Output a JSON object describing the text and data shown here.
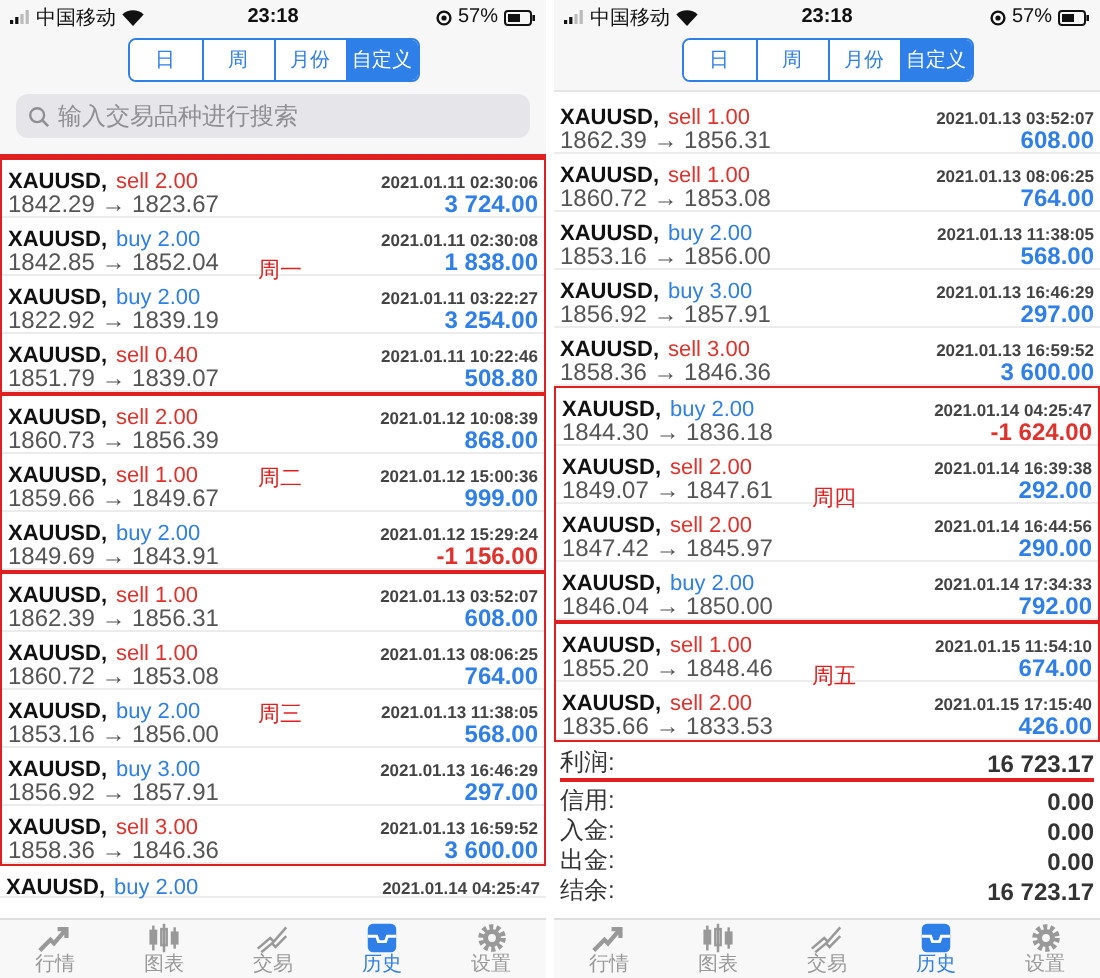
{
  "panels": [
    {
      "status_bar": {
        "carrier": "中国移动",
        "time": "23:18",
        "battery": "57%"
      },
      "segments": [
        {
          "label": "日",
          "selected": false
        },
        {
          "label": "周",
          "selected": false
        },
        {
          "label": "月份",
          "selected": false
        },
        {
          "label": "自定义",
          "selected": true
        }
      ],
      "search": {
        "placeholder": "输入交易品种进行搜索"
      },
      "groups": [
        {
          "annotation": "周一",
          "rows": [
            {
              "symbol": "XAUUSD,",
              "volume": "sell 2.00",
              "color": "#e0322c",
              "time": "2021.01.11 02:30:06",
              "prices": "1842.29 → 1823.67",
              "profit": "3 724.00",
              "loss": false
            },
            {
              "symbol": "XAUUSD,",
              "volume": "buy 2.00",
              "color": "#2f7fe8",
              "time": "2021.01.11 02:30:08",
              "prices": "1842.85 → 1852.04",
              "profit": "1 838.00",
              "loss": false
            },
            {
              "symbol": "XAUUSD,",
              "volume": "buy 2.00",
              "color": "#2f7fe8",
              "time": "2021.01.11 03:22:27",
              "prices": "1822.92 → 1839.19",
              "profit": "3 254.00",
              "loss": false
            },
            {
              "symbol": "XAUUSD,",
              "volume": "sell 0.40",
              "color": "#e0322c",
              "time": "2021.01.11 10:22:46",
              "prices": "1851.79 → 1839.07",
              "profit": "508.80",
              "loss": false
            }
          ]
        },
        {
          "annotation": "周二",
          "rows": [
            {
              "symbol": "XAUUSD,",
              "volume": "sell 2.00",
              "color": "#e0322c",
              "time": "2021.01.12 10:08:39",
              "prices": "1860.73 → 1856.39",
              "profit": "868.00",
              "loss": false
            },
            {
              "symbol": "XAUUSD,",
              "volume": "sell 1.00",
              "color": "#e0322c",
              "time": "2021.01.12 15:00:36",
              "prices": "1859.66 → 1849.67",
              "profit": "999.00",
              "loss": false
            },
            {
              "symbol": "XAUUSD,",
              "volume": "buy 2.00",
              "color": "#2f7fe8",
              "time": "2021.01.12 15:29:24",
              "prices": "1849.69 → 1843.91",
              "profit": "-1 156.00",
              "loss": true
            }
          ]
        },
        {
          "annotation": "周三",
          "rows": [
            {
              "symbol": "XAUUSD,",
              "volume": "sell 1.00",
              "color": "#e0322c",
              "time": "2021.01.13 03:52:07",
              "prices": "1862.39 → 1856.31",
              "profit": "608.00",
              "loss": false
            },
            {
              "symbol": "XAUUSD,",
              "volume": "sell 1.00",
              "color": "#e0322c",
              "time": "2021.01.13 08:06:25",
              "prices": "1860.72 → 1853.08",
              "profit": "764.00",
              "loss": false
            },
            {
              "symbol": "XAUUSD,",
              "volume": "buy 2.00",
              "color": "#2f7fe8",
              "time": "2021.01.13 11:38:05",
              "prices": "1853.16 → 1856.00",
              "profit": "568.00",
              "loss": false
            },
            {
              "symbol": "XAUUSD,",
              "volume": "buy 3.00",
              "color": "#2f7fe8",
              "time": "2021.01.13 16:46:29",
              "prices": "1856.92 → 1857.91",
              "profit": "297.00",
              "loss": false
            },
            {
              "symbol": "XAUUSD,",
              "volume": "sell 3.00",
              "color": "#e0322c",
              "time": "2021.01.13 16:59:52",
              "prices": "1858.36 → 1846.36",
              "profit": "3 600.00",
              "loss": false
            }
          ]
        },
        {
          "rows": [
            {
              "symbol": "XAUUSD,",
              "volume": "buy 2.00",
              "color": "#2f7fe8",
              "time": "2021.01.14 04:25:47"
            }
          ]
        }
      ],
      "tabs": [
        {
          "label": "行情",
          "kind": "quotes",
          "selected": false
        },
        {
          "label": "图表",
          "kind": "chart",
          "selected": false
        },
        {
          "label": "交易",
          "kind": "trade",
          "selected": false
        },
        {
          "label": "历史",
          "kind": "history",
          "selected": true
        },
        {
          "label": "设置",
          "kind": "settings",
          "selected": false
        }
      ]
    },
    {
      "status_bar": {
        "carrier": "中国移动",
        "time": "23:18",
        "battery": "57%"
      },
      "segments": [
        {
          "label": "日",
          "selected": false
        },
        {
          "label": "周",
          "selected": false
        },
        {
          "label": "月份",
          "selected": false
        },
        {
          "label": "自定义",
          "selected": true
        }
      ],
      "groups": [
        {
          "rows": [
            {
              "symbol": "XAUUSD,",
              "volume": "sell 1.00",
              "color": "#e0322c",
              "time": "2021.01.13 03:52:07",
              "prices": "1862.39 → 1856.31",
              "profit": "608.00",
              "loss": false
            },
            {
              "symbol": "XAUUSD,",
              "volume": "sell 1.00",
              "color": "#e0322c",
              "time": "2021.01.13 08:06:25",
              "prices": "1860.72 → 1853.08",
              "profit": "764.00",
              "loss": false
            },
            {
              "symbol": "XAUUSD,",
              "volume": "buy 2.00",
              "color": "#2f7fe8",
              "time": "2021.01.13 11:38:05",
              "prices": "1853.16 → 1856.00",
              "profit": "568.00",
              "loss": false
            },
            {
              "symbol": "XAUUSD,",
              "volume": "buy 3.00",
              "color": "#2f7fe8",
              "time": "2021.01.13 16:46:29",
              "prices": "1856.92 → 1857.91",
              "profit": "297.00",
              "loss": false
            },
            {
              "symbol": "XAUUSD,",
              "volume": "sell 3.00",
              "color": "#e0322c",
              "time": "2021.01.13 16:59:52",
              "prices": "1858.36 → 1846.36",
              "profit": "3 600.00",
              "loss": false
            }
          ]
        },
        {
          "annotation": "周四",
          "rows": [
            {
              "symbol": "XAUUSD,",
              "volume": "buy 2.00",
              "color": "#2f7fe8",
              "time": "2021.01.14 04:25:47",
              "prices": "1844.30 → 1836.18",
              "profit": "-1 624.00",
              "loss": true
            },
            {
              "symbol": "XAUUSD,",
              "volume": "sell 2.00",
              "color": "#e0322c",
              "time": "2021.01.14 16:39:38",
              "prices": "1849.07 → 1847.61",
              "profit": "292.00",
              "loss": false
            },
            {
              "symbol": "XAUUSD,",
              "volume": "sell 2.00",
              "color": "#e0322c",
              "time": "2021.01.14 16:44:56",
              "prices": "1847.42 → 1845.97",
              "profit": "290.00",
              "loss": false
            },
            {
              "symbol": "XAUUSD,",
              "volume": "buy 2.00",
              "color": "#2f7fe8",
              "time": "2021.01.14 17:34:33",
              "prices": "1846.04 → 1850.00",
              "profit": "792.00",
              "loss": false
            }
          ]
        },
        {
          "annotation": "周五",
          "rows": [
            {
              "symbol": "XAUUSD,",
              "volume": "sell 1.00",
              "color": "#e0322c",
              "time": "2021.01.15 11:54:10",
              "prices": "1855.20 → 1848.46",
              "profit": "674.00",
              "loss": false
            },
            {
              "symbol": "XAUUSD,",
              "volume": "sell 2.00",
              "color": "#e0322c",
              "time": "2021.01.15 17:15:40",
              "prices": "1835.66 → 1833.53",
              "profit": "426.00",
              "loss": false
            }
          ]
        }
      ],
      "summary": [
        {
          "label": "利润:",
          "value": "16 723.17",
          "underlined": true
        },
        {
          "label": "信用:",
          "value": "0.00",
          "underlined": false
        },
        {
          "label": "入金:",
          "value": "0.00",
          "underlined": false
        },
        {
          "label": "出金:",
          "value": "0.00",
          "underlined": false
        },
        {
          "label": "结余:",
          "value": "16 723.17",
          "underlined": false
        }
      ],
      "tabs": [
        {
          "label": "行情",
          "kind": "quotes",
          "selected": false
        },
        {
          "label": "图表",
          "kind": "chart",
          "selected": false
        },
        {
          "label": "交易",
          "kind": "trade",
          "selected": false
        },
        {
          "label": "历史",
          "kind": "history",
          "selected": true
        },
        {
          "label": "设置",
          "kind": "settings",
          "selected": false
        }
      ]
    }
  ]
}
